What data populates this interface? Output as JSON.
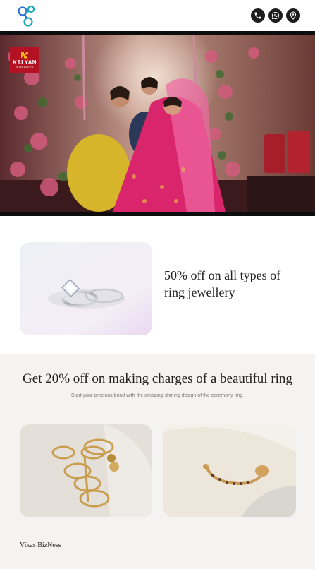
{
  "header": {
    "logo_icon": "chain-link-logo-icon",
    "actions": [
      {
        "icon": "phone-icon"
      },
      {
        "icon": "whatsapp-icon"
      },
      {
        "icon": "location-pin-icon"
      }
    ],
    "accent_color": "#1aa8b8"
  },
  "hero": {
    "brand_name": "KALYAN",
    "brand_tagline": "JEWELLERS",
    "brand_color": "#b41222"
  },
  "offer_ring": {
    "title": "50% off on all types of ring jewellery"
  },
  "offer_making": {
    "title": "Get 20% off on making charges of a beautiful ring",
    "subtitle": "Start your precious bond with the amazing shining design of the ceremony ring."
  },
  "footer": {
    "brand": "Vikas BizNess"
  }
}
